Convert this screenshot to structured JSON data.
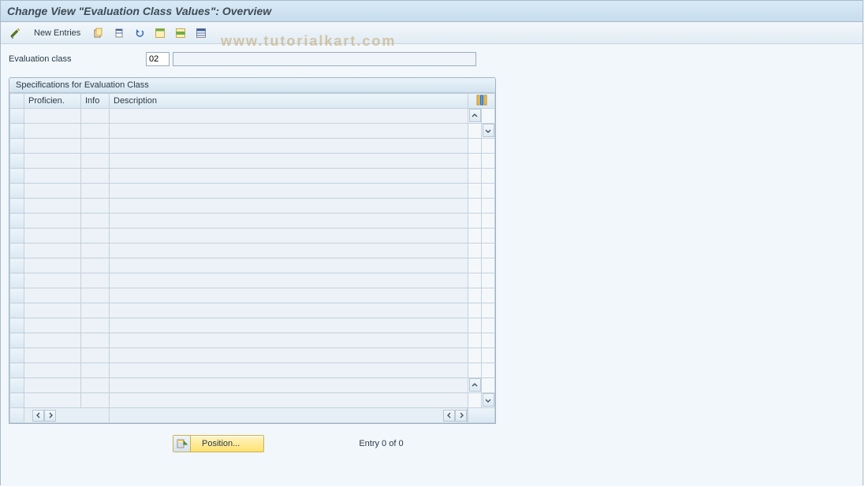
{
  "window": {
    "title": "Change View \"Evaluation Class Values\": Overview"
  },
  "toolbar": {
    "new_entries_label": "New Entries",
    "icons": {
      "toggle": "toggle-pencil-glasses",
      "copy_as": "copy-as",
      "delete": "delete",
      "undo": "undo",
      "select_all": "select-all",
      "select_block": "select-block",
      "deselect_all": "deselect-all"
    }
  },
  "fields": {
    "evaluation_class_label": "Evaluation class",
    "evaluation_class_code": "02",
    "evaluation_class_desc": ""
  },
  "panel": {
    "title": "Specifications for Evaluation Class",
    "columns": {
      "proficiency": "Proficien.",
      "info": "Info",
      "description": "Description"
    },
    "row_count": 20
  },
  "footer": {
    "position_label": "Position...",
    "status_text": "Entry 0 of 0"
  },
  "watermark": "www.tutorialkart.com"
}
